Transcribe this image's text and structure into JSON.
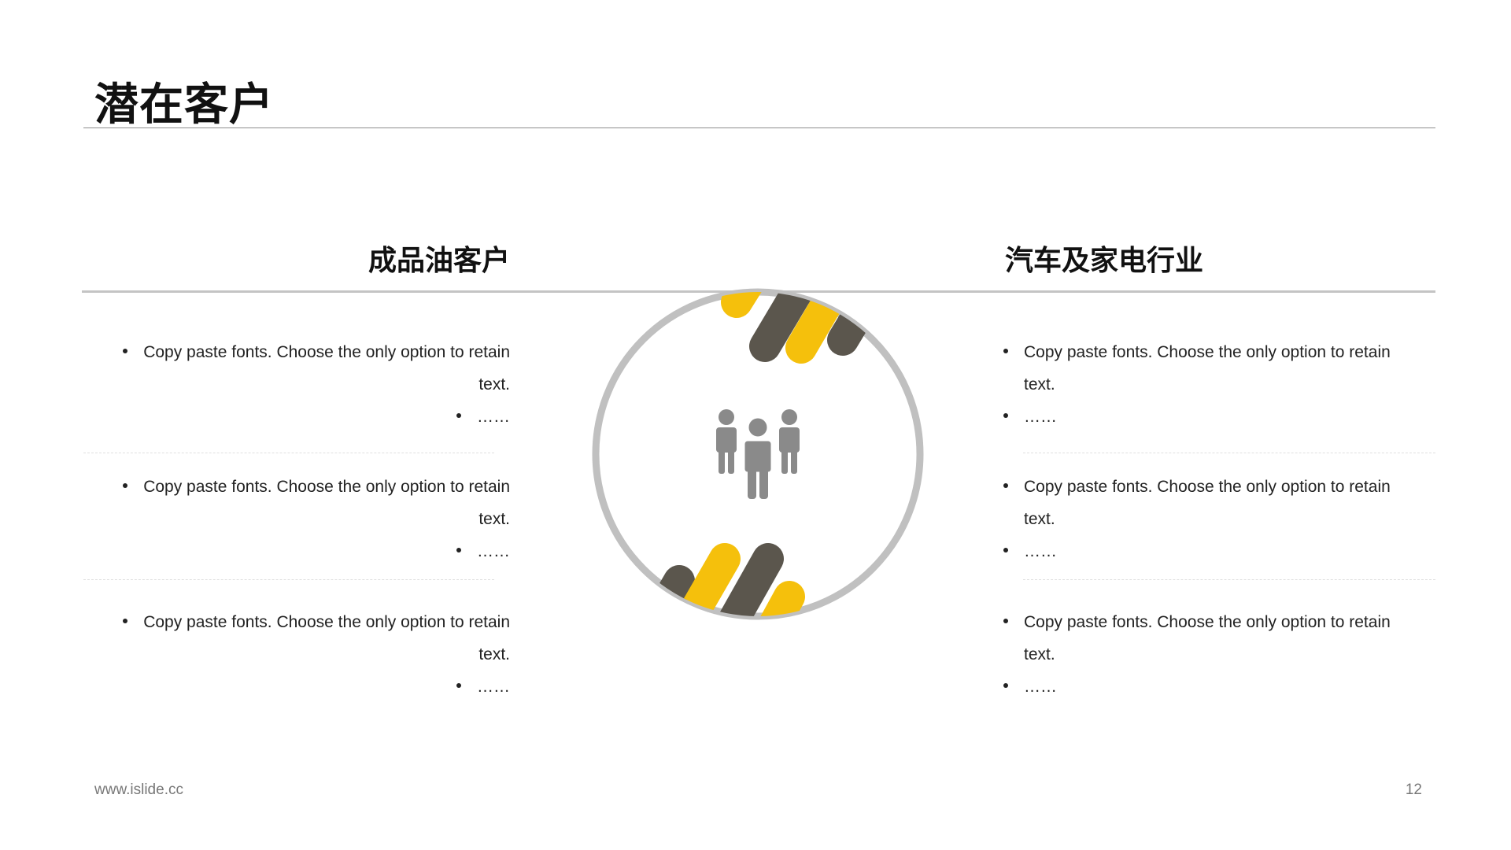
{
  "title": "潜在客户",
  "left": {
    "heading": "成品油客户",
    "items": [
      {
        "text": "Copy paste fonts. Choose the only option to retain",
        "cont": "text.",
        "sub": "……"
      },
      {
        "text": "Copy paste fonts. Choose the only option to retain",
        "cont": "text.",
        "sub": "……"
      },
      {
        "text": "Copy paste fonts. Choose the only option to retain",
        "cont": "text.",
        "sub": "……"
      }
    ]
  },
  "right": {
    "heading": "汽车及家电行业",
    "items": [
      {
        "text": "Copy paste fonts. Choose the only option to retain",
        "cont": "text.",
        "sub": "……"
      },
      {
        "text": "Copy paste fonts. Choose the only option to retain",
        "cont": "text.",
        "sub": "……"
      },
      {
        "text": "Copy paste fonts. Choose the only option to retain",
        "cont": "text.",
        "sub": "……"
      }
    ]
  },
  "center": {
    "icon": "people-group-icon"
  },
  "colors": {
    "accent_yellow": "#f5c00c",
    "accent_dark": "#5b564d",
    "ring_gray": "#c0c0c0",
    "icon_gray": "#8a8a8a"
  },
  "footer": {
    "url": "www.islide.cc",
    "page": "12"
  }
}
